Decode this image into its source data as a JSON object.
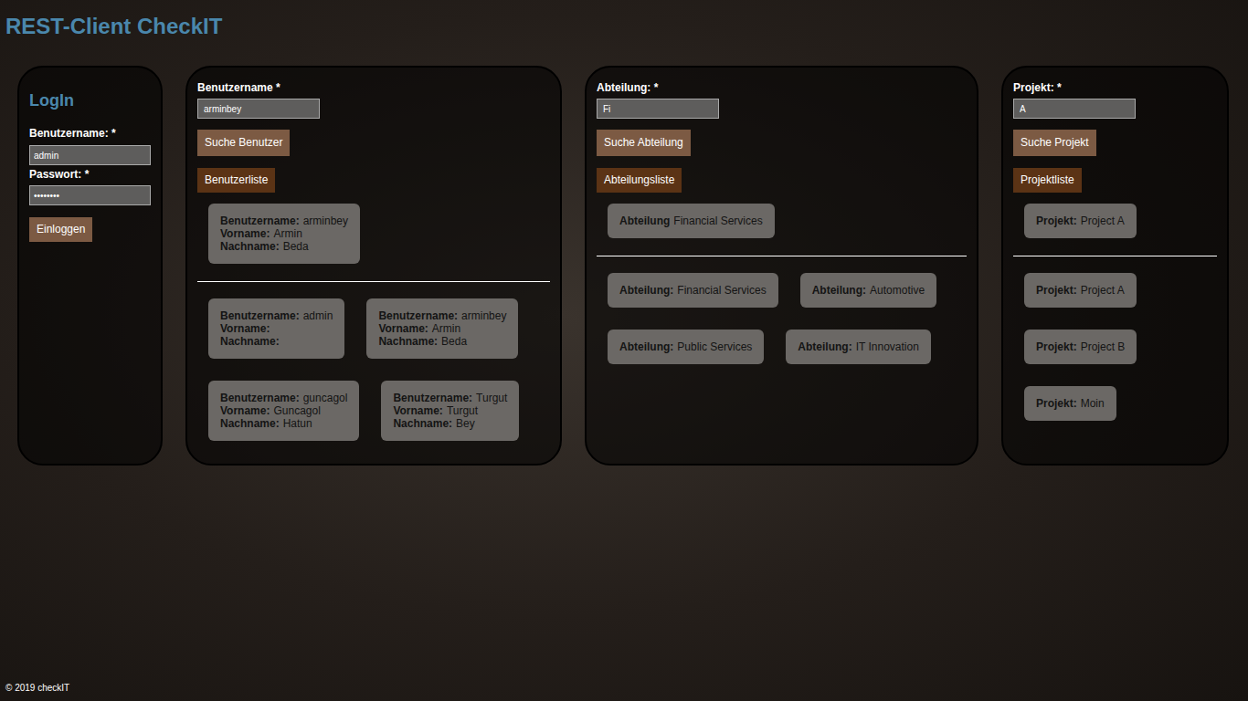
{
  "header": {
    "title": "REST-Client CheckIT"
  },
  "login": {
    "title": "LogIn",
    "fields": [
      {
        "label": "Benutzername: *",
        "value": "admin"
      },
      {
        "label": "Passwort: *",
        "value": "••••••••"
      }
    ],
    "button": "Einloggen"
  },
  "panels": [
    {
      "label": "Benutzername *",
      "value": "arminbey",
      "search_button": "Suche Benutzer",
      "list_button": "Benutzerliste",
      "results": [
        {
          "fields": [
            {
              "label": "Benutzername:",
              "value": "arminbey"
            },
            {
              "label": "Vorname:",
              "value": "Armin"
            },
            {
              "label": "Nachname:",
              "value": "Beda"
            }
          ]
        }
      ],
      "list": [
        {
          "fields": [
            {
              "label": "Benutzername:",
              "value": "admin"
            },
            {
              "label": "Vorname:",
              "value": ""
            },
            {
              "label": "Nachname:",
              "value": ""
            }
          ]
        },
        {
          "fields": [
            {
              "label": "Benutzername:",
              "value": "arminbey"
            },
            {
              "label": "Vorname:",
              "value": "Armin"
            },
            {
              "label": "Nachname:",
              "value": "Beda"
            }
          ]
        },
        {
          "fields": [
            {
              "label": "Benutzername:",
              "value": "guncagol"
            },
            {
              "label": "Vorname:",
              "value": "Guncagol"
            },
            {
              "label": "Nachname:",
              "value": "Hatun"
            }
          ]
        },
        {
          "fields": [
            {
              "label": "Benutzername:",
              "value": "Turgut"
            },
            {
              "label": "Vorname:",
              "value": "Turgut"
            },
            {
              "label": "Nachname:",
              "value": "Bey"
            }
          ]
        }
      ]
    },
    {
      "label": "Abteilung: *",
      "value": "Fi",
      "search_button": "Suche Abteilung",
      "list_button": "Abteilungsliste",
      "results": [
        {
          "fields": [
            {
              "label": "Abteilung",
              "value": "Financial Services"
            }
          ]
        }
      ],
      "list": [
        {
          "fields": [
            {
              "label": "Abteilung:",
              "value": "Financial Services"
            }
          ]
        },
        {
          "fields": [
            {
              "label": "Abteilung:",
              "value": "Automotive"
            }
          ]
        },
        {
          "fields": [
            {
              "label": "Abteilung:",
              "value": "Public Services"
            }
          ]
        },
        {
          "fields": [
            {
              "label": "Abteilung:",
              "value": "IT Innovation"
            }
          ]
        }
      ]
    },
    {
      "label": "Projekt: *",
      "value": "A",
      "search_button": "Suche Projekt",
      "list_button": "Projektliste",
      "results": [
        {
          "fields": [
            {
              "label": "Projekt:",
              "value": "Project A"
            }
          ]
        }
      ],
      "list": [
        {
          "fields": [
            {
              "label": "Projekt:",
              "value": "Project A"
            }
          ]
        },
        {
          "fields": [
            {
              "label": "Projekt:",
              "value": "Project B"
            }
          ]
        },
        {
          "fields": [
            {
              "label": "Projekt:",
              "value": "Moin"
            }
          ]
        }
      ]
    }
  ],
  "footer": "© 2019 checkIT"
}
